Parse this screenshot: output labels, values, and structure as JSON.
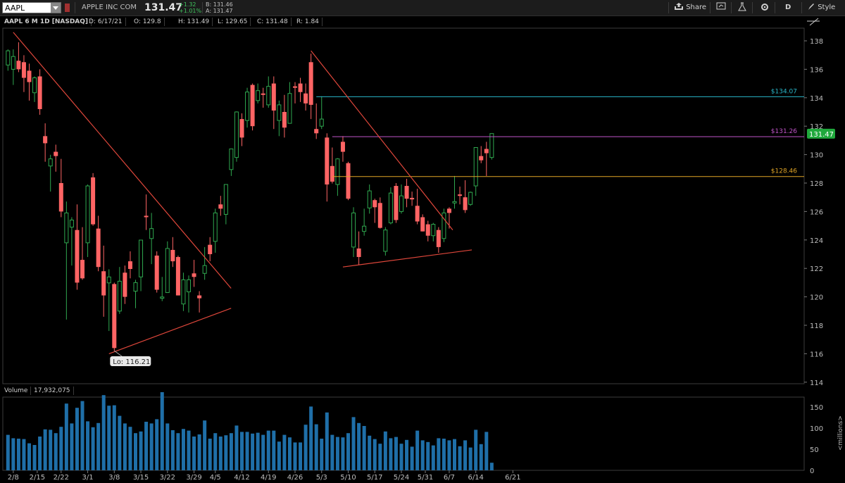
{
  "toolbar": {
    "symbol": "AAPL",
    "company": "APPLE INC COM",
    "last": "131.47",
    "change": "+1.32",
    "change_pct": "+1.01%",
    "bid": "B: 131.46",
    "ask": "A: 131.47",
    "share_label": "Share",
    "period_label": "D",
    "style_label": "Style"
  },
  "infobar": {
    "title": "AAPL 6 M 1D [NASDAQ]",
    "date": "D: 6/17/21",
    "open": "O: 129.8",
    "high": "H: 131.49",
    "low": "L: 129.65",
    "close": "C: 131.48",
    "range": "R: 1.84"
  },
  "volume_bar": {
    "label": "Volume",
    "value": "17,932,075"
  },
  "colors": {
    "up": "#2fa84f",
    "down": "#ff6464",
    "volume": "#1f6fa8",
    "trend": "#e0473b",
    "res_cyan": "#2ab7c9",
    "res_magenta": "#c054c8",
    "res_gold": "#e0a526",
    "last_badge": "#1fa83c"
  },
  "chart_data": {
    "type": "candlestick",
    "ticker": "AAPL",
    "y_ticks": [
      138,
      136,
      134,
      132,
      130,
      128,
      126,
      124,
      122,
      120,
      118,
      116,
      114
    ],
    "ylim": [
      114,
      139
    ],
    "volume_ticks": [
      150,
      100,
      50,
      0
    ],
    "volume_ylim": [
      0,
      185
    ],
    "volume_unit": "<millions>",
    "x_ticks": [
      "2/8",
      "2/15",
      "2/22",
      "3/1",
      "3/8",
      "3/15",
      "3/22",
      "3/29",
      "4/5",
      "4/12",
      "4/19",
      "4/26",
      "5/3",
      "5/10",
      "5/17",
      "5/24",
      "5/31",
      "6/7",
      "6/14",
      "6/21"
    ],
    "candles": [
      {
        "date": "2/5",
        "o": 136.3,
        "h": 137.4,
        "l": 135.9,
        "c": 137.3,
        "v": 84
      },
      {
        "date": "2/8",
        "o": 136.0,
        "h": 137.4,
        "l": 134.9,
        "c": 136.9,
        "v": 76
      },
      {
        "date": "2/9",
        "o": 136.6,
        "h": 137.9,
        "l": 135.8,
        "c": 136.0,
        "v": 75
      },
      {
        "date": "2/10",
        "o": 136.5,
        "h": 136.99,
        "l": 134.4,
        "c": 135.4,
        "v": 74
      },
      {
        "date": "2/11",
        "o": 135.9,
        "h": 136.4,
        "l": 133.8,
        "c": 135.1,
        "v": 64
      },
      {
        "date": "2/12",
        "o": 134.35,
        "h": 135.5,
        "l": 133.7,
        "c": 135.4,
        "v": 60
      },
      {
        "date": "2/16",
        "o": 135.5,
        "h": 136.0,
        "l": 132.8,
        "c": 133.2,
        "v": 80
      },
      {
        "date": "2/17",
        "o": 131.3,
        "h": 132.2,
        "l": 129.5,
        "c": 130.8,
        "v": 97
      },
      {
        "date": "2/18",
        "o": 129.2,
        "h": 129.99,
        "l": 127.4,
        "c": 129.7,
        "v": 96
      },
      {
        "date": "2/19",
        "o": 130.2,
        "h": 130.7,
        "l": 128.8,
        "c": 129.9,
        "v": 88
      },
      {
        "date": "2/22",
        "o": 128.0,
        "h": 129.7,
        "l": 125.6,
        "c": 126.0,
        "v": 103
      },
      {
        "date": "2/23",
        "o": 123.8,
        "h": 126.7,
        "l": 118.4,
        "c": 125.9,
        "v": 158
      },
      {
        "date": "2/24",
        "o": 124.9,
        "h": 125.6,
        "l": 122.2,
        "c": 125.4,
        "v": 111
      },
      {
        "date": "2/25",
        "o": 124.7,
        "h": 126.5,
        "l": 120.5,
        "c": 121.0,
        "v": 148
      },
      {
        "date": "2/26",
        "o": 122.6,
        "h": 124.9,
        "l": 121.2,
        "c": 121.3,
        "v": 164
      },
      {
        "date": "3/1",
        "o": 123.8,
        "h": 127.9,
        "l": 122.8,
        "c": 127.8,
        "v": 116
      },
      {
        "date": "3/2",
        "o": 128.4,
        "h": 128.7,
        "l": 125.0,
        "c": 125.1,
        "v": 102
      },
      {
        "date": "3/3",
        "o": 124.8,
        "h": 125.7,
        "l": 121.8,
        "c": 122.1,
        "v": 112
      },
      {
        "date": "3/4",
        "o": 121.8,
        "h": 123.6,
        "l": 118.6,
        "c": 120.1,
        "v": 178
      },
      {
        "date": "3/5",
        "o": 120.98,
        "h": 121.94,
        "l": 117.6,
        "c": 121.4,
        "v": 153
      },
      {
        "date": "3/8",
        "o": 120.9,
        "h": 121.0,
        "l": 116.21,
        "c": 116.4,
        "v": 154
      },
      {
        "date": "3/9",
        "o": 119.0,
        "h": 122.1,
        "l": 118.8,
        "c": 121.1,
        "v": 129
      },
      {
        "date": "3/10",
        "o": 121.7,
        "h": 122.2,
        "l": 119.5,
        "c": 120.0,
        "v": 111
      },
      {
        "date": "3/11",
        "o": 122.5,
        "h": 123.2,
        "l": 121.3,
        "c": 121.96,
        "v": 103
      },
      {
        "date": "3/12",
        "o": 120.4,
        "h": 121.2,
        "l": 119.2,
        "c": 121.0,
        "v": 88
      },
      {
        "date": "3/15",
        "o": 121.4,
        "h": 124.0,
        "l": 120.4,
        "c": 123.99,
        "v": 92
      },
      {
        "date": "3/16",
        "o": 125.7,
        "h": 127.2,
        "l": 124.7,
        "c": 125.6,
        "v": 115
      },
      {
        "date": "3/17",
        "o": 124.1,
        "h": 125.9,
        "l": 122.3,
        "c": 124.8,
        "v": 111
      },
      {
        "date": "3/18",
        "o": 122.9,
        "h": 123.2,
        "l": 120.3,
        "c": 120.5,
        "v": 121
      },
      {
        "date": "3/19",
        "o": 119.9,
        "h": 121.4,
        "l": 119.7,
        "c": 119.99,
        "v": 185
      },
      {
        "date": "3/22",
        "o": 120.3,
        "h": 123.9,
        "l": 120.3,
        "c": 123.4,
        "v": 111
      },
      {
        "date": "3/23",
        "o": 123.3,
        "h": 124.2,
        "l": 122.1,
        "c": 122.5,
        "v": 95
      },
      {
        "date": "3/24",
        "o": 122.8,
        "h": 122.9,
        "l": 120.1,
        "c": 120.1,
        "v": 88
      },
      {
        "date": "3/25",
        "o": 119.5,
        "h": 121.7,
        "l": 119.0,
        "c": 121.2,
        "v": 98
      },
      {
        "date": "3/26",
        "o": 120.35,
        "h": 121.5,
        "l": 118.9,
        "c": 121.2,
        "v": 94
      },
      {
        "date": "3/29",
        "o": 121.65,
        "h": 122.6,
        "l": 120.7,
        "c": 121.4,
        "v": 80
      },
      {
        "date": "3/30",
        "o": 120.1,
        "h": 120.4,
        "l": 118.9,
        "c": 119.9,
        "v": 85
      },
      {
        "date": "3/31",
        "o": 121.65,
        "h": 123.5,
        "l": 121.2,
        "c": 122.2,
        "v": 118
      },
      {
        "date": "4/1",
        "o": 123.66,
        "h": 124.2,
        "l": 122.5,
        "c": 123.0,
        "v": 75
      },
      {
        "date": "4/5",
        "o": 123.9,
        "h": 126.2,
        "l": 123.1,
        "c": 125.9,
        "v": 88
      },
      {
        "date": "4/6",
        "o": 126.5,
        "h": 127.1,
        "l": 125.7,
        "c": 126.2,
        "v": 80
      },
      {
        "date": "4/7",
        "o": 125.8,
        "h": 127.9,
        "l": 125.1,
        "c": 127.9,
        "v": 83
      },
      {
        "date": "4/8",
        "o": 128.95,
        "h": 130.4,
        "l": 128.5,
        "c": 130.4,
        "v": 88
      },
      {
        "date": "4/9",
        "o": 129.8,
        "h": 133.04,
        "l": 129.5,
        "c": 133.0,
        "v": 106
      },
      {
        "date": "4/12",
        "o": 132.5,
        "h": 132.9,
        "l": 130.6,
        "c": 131.2,
        "v": 91
      },
      {
        "date": "4/13",
        "o": 132.4,
        "h": 134.7,
        "l": 131.9,
        "c": 134.4,
        "v": 91
      },
      {
        "date": "4/14",
        "o": 134.9,
        "h": 135.0,
        "l": 131.7,
        "c": 132.0,
        "v": 87
      },
      {
        "date": "4/15",
        "o": 133.8,
        "h": 135.0,
        "l": 133.6,
        "c": 134.5,
        "v": 89
      },
      {
        "date": "4/16",
        "o": 134.3,
        "h": 134.7,
        "l": 133.3,
        "c": 134.2,
        "v": 84
      },
      {
        "date": "4/19",
        "o": 133.5,
        "h": 135.5,
        "l": 133.3,
        "c": 134.8,
        "v": 94
      },
      {
        "date": "4/20",
        "o": 135.0,
        "h": 135.5,
        "l": 131.8,
        "c": 133.1,
        "v": 94
      },
      {
        "date": "4/21",
        "o": 132.4,
        "h": 133.8,
        "l": 131.3,
        "c": 133.5,
        "v": 68
      },
      {
        "date": "4/22",
        "o": 133.0,
        "h": 134.2,
        "l": 131.2,
        "c": 131.9,
        "v": 84
      },
      {
        "date": "4/23",
        "o": 132.2,
        "h": 135.1,
        "l": 132.2,
        "c": 134.3,
        "v": 78
      },
      {
        "date": "4/26",
        "o": 134.8,
        "h": 135.1,
        "l": 133.6,
        "c": 134.7,
        "v": 66
      },
      {
        "date": "4/27",
        "o": 135.0,
        "h": 135.4,
        "l": 133.7,
        "c": 134.4,
        "v": 66
      },
      {
        "date": "4/28",
        "o": 134.3,
        "h": 135.0,
        "l": 133.1,
        "c": 133.6,
        "v": 108
      },
      {
        "date": "4/29",
        "o": 136.5,
        "h": 137.1,
        "l": 132.5,
        "c": 133.5,
        "v": 151
      },
      {
        "date": "4/30",
        "o": 131.8,
        "h": 133.6,
        "l": 131.1,
        "c": 131.5,
        "v": 109
      },
      {
        "date": "5/3",
        "o": 132.0,
        "h": 134.1,
        "l": 131.8,
        "c": 132.5,
        "v": 75
      },
      {
        "date": "5/4",
        "o": 131.2,
        "h": 131.5,
        "l": 126.7,
        "c": 127.9,
        "v": 137
      },
      {
        "date": "5/5",
        "o": 129.2,
        "h": 130.5,
        "l": 127.97,
        "c": 128.1,
        "v": 84
      },
      {
        "date": "5/6",
        "o": 127.9,
        "h": 129.75,
        "l": 127.1,
        "c": 129.7,
        "v": 79
      },
      {
        "date": "5/7",
        "o": 130.9,
        "h": 131.3,
        "l": 129.5,
        "c": 130.2,
        "v": 78
      },
      {
        "date": "5/10",
        "o": 129.4,
        "h": 129.5,
        "l": 126.8,
        "c": 126.9,
        "v": 88
      },
      {
        "date": "5/11",
        "o": 123.5,
        "h": 126.3,
        "l": 122.8,
        "c": 125.9,
        "v": 126
      },
      {
        "date": "5/12",
        "o": 123.4,
        "h": 124.6,
        "l": 122.25,
        "c": 122.8,
        "v": 112
      },
      {
        "date": "5/13",
        "o": 124.6,
        "h": 126.2,
        "l": 124.3,
        "c": 124.97,
        "v": 105
      },
      {
        "date": "5/14",
        "o": 126.25,
        "h": 127.9,
        "l": 125.85,
        "c": 127.45,
        "v": 82
      },
      {
        "date": "5/17",
        "o": 126.8,
        "h": 126.9,
        "l": 125.2,
        "c": 126.3,
        "v": 74
      },
      {
        "date": "5/18",
        "o": 126.6,
        "h": 126.99,
        "l": 124.8,
        "c": 124.85,
        "v": 63
      },
      {
        "date": "5/19",
        "o": 123.2,
        "h": 124.9,
        "l": 122.9,
        "c": 124.7,
        "v": 92
      },
      {
        "date": "5/20",
        "o": 125.2,
        "h": 127.7,
        "l": 125.1,
        "c": 127.3,
        "v": 76
      },
      {
        "date": "5/21",
        "o": 127.8,
        "h": 128.0,
        "l": 125.2,
        "c": 125.4,
        "v": 79
      },
      {
        "date": "5/24",
        "o": 126.0,
        "h": 127.9,
        "l": 125.85,
        "c": 127.1,
        "v": 63
      },
      {
        "date": "5/25",
        "o": 127.8,
        "h": 128.3,
        "l": 126.3,
        "c": 126.9,
        "v": 72
      },
      {
        "date": "5/26",
        "o": 126.96,
        "h": 127.4,
        "l": 126.4,
        "c": 126.85,
        "v": 56
      },
      {
        "date": "5/27",
        "o": 126.4,
        "h": 127.6,
        "l": 125.1,
        "c": 125.3,
        "v": 94
      },
      {
        "date": "5/28",
        "o": 125.6,
        "h": 125.8,
        "l": 124.6,
        "c": 124.6,
        "v": 71
      },
      {
        "date": "6/1",
        "o": 125.1,
        "h": 125.35,
        "l": 123.9,
        "c": 124.3,
        "v": 67
      },
      {
        "date": "6/2",
        "o": 124.3,
        "h": 125.2,
        "l": 123.9,
        "c": 125.1,
        "v": 59
      },
      {
        "date": "6/3",
        "o": 124.7,
        "h": 124.9,
        "l": 123.1,
        "c": 123.5,
        "v": 76
      },
      {
        "date": "6/4",
        "o": 124.1,
        "h": 126.2,
        "l": 123.85,
        "c": 125.9,
        "v": 75
      },
      {
        "date": "6/7",
        "o": 126.2,
        "h": 126.3,
        "l": 124.8,
        "c": 125.9,
        "v": 71
      },
      {
        "date": "6/8",
        "o": 126.6,
        "h": 128.5,
        "l": 126.2,
        "c": 126.7,
        "v": 74
      },
      {
        "date": "6/9",
        "o": 127.2,
        "h": 127.75,
        "l": 126.5,
        "c": 127.1,
        "v": 57
      },
      {
        "date": "6/10",
        "o": 127.0,
        "h": 128.2,
        "l": 125.9,
        "c": 126.1,
        "v": 71
      },
      {
        "date": "6/11",
        "o": 126.5,
        "h": 127.4,
        "l": 126.4,
        "c": 127.35,
        "v": 54
      },
      {
        "date": "6/14",
        "o": 127.8,
        "h": 130.5,
        "l": 127.1,
        "c": 130.5,
        "v": 96
      },
      {
        "date": "6/15",
        "o": 129.9,
        "h": 130.6,
        "l": 129.4,
        "c": 129.6,
        "v": 62
      },
      {
        "date": "6/16",
        "o": 130.4,
        "h": 130.9,
        "l": 128.5,
        "c": 130.1,
        "v": 91
      },
      {
        "date": "6/17",
        "o": 129.8,
        "h": 131.49,
        "l": 129.65,
        "c": 131.48,
        "v": 18
      }
    ],
    "levels": [
      {
        "value": 134.07,
        "label": "$134.07",
        "color": "#2ab7c9"
      },
      {
        "value": 131.26,
        "label": "$131.26",
        "color": "#c054c8"
      },
      {
        "value": 128.46,
        "label": "$128.46",
        "color": "#e0a526"
      }
    ],
    "trendlines": [
      {
        "from": [
          "2/8",
          138.6
        ],
        "to": [
          "4/1",
          120.6
        ]
      },
      {
        "from": [
          "3/5",
          116.0
        ],
        "to": [
          "4/1",
          119.2
        ]
      },
      {
        "from": [
          "4/29",
          137.3
        ],
        "to": [
          "6/7",
          124.7
        ]
      },
      {
        "from": [
          "5/7",
          122.1
        ],
        "to": [
          "6/9",
          123.3
        ]
      }
    ],
    "low_label": {
      "date": "3/8",
      "text": "Lo: 116.21"
    },
    "last_badge": "131.47"
  }
}
